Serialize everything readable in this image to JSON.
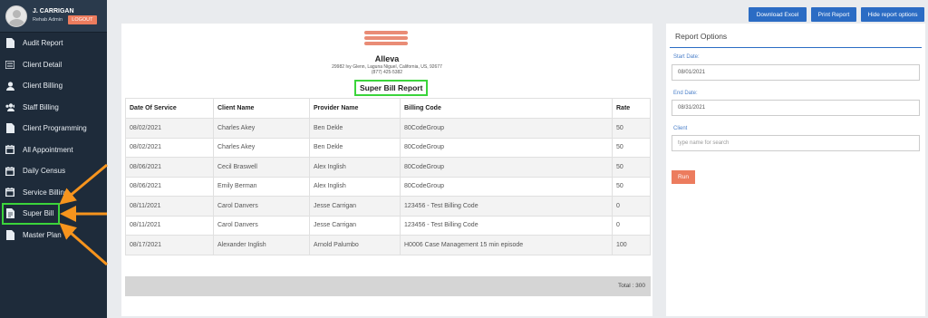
{
  "profile": {
    "name": "J. CARRIGAN",
    "role": "Rehab Admin",
    "logout": "LOGOUT"
  },
  "nav": [
    {
      "label": "Audit Report",
      "icon": "file-icon"
    },
    {
      "label": "Client Detail",
      "icon": "list-icon"
    },
    {
      "label": "Client Billing",
      "icon": "user-icon"
    },
    {
      "label": "Staff Billing",
      "icon": "users-icon"
    },
    {
      "label": "Client Programming",
      "icon": "file-icon"
    },
    {
      "label": "All Appointment",
      "icon": "calendar-icon"
    },
    {
      "label": "Daily Census",
      "icon": "calendar-icon"
    },
    {
      "label": "Service Billing",
      "icon": "calendar-icon"
    },
    {
      "label": "Super Bill",
      "icon": "document-icon"
    },
    {
      "label": "Master Plan",
      "icon": "file-icon"
    }
  ],
  "toolbar": {
    "download": "Download Excel",
    "print": "Print Report",
    "hide": "Hide report options"
  },
  "company": {
    "name": "Alleva",
    "address": "29982 Ivy Glenn, Laguna Niguel, California, US, 92677",
    "phone": "(877) 425-5382"
  },
  "report_title": "Super Bill Report",
  "table": {
    "headers": [
      "Date Of Service",
      "Client Name",
      "Provider Name",
      "Billing Code",
      "Rate"
    ],
    "rows": [
      [
        "08/02/2021",
        "Charles Akey",
        "Ben Dekle",
        "80CodeGroup",
        "50"
      ],
      [
        "08/02/2021",
        "Charles Akey",
        "Ben Dekle",
        "80CodeGroup",
        "50"
      ],
      [
        "08/06/2021",
        "Cecil Braswell",
        "Alex Inglish",
        "80CodeGroup",
        "50"
      ],
      [
        "08/06/2021",
        "Emily Berman",
        "Alex Inglish",
        "80CodeGroup",
        "50"
      ],
      [
        "08/11/2021",
        "Carol Danvers",
        "Jesse Carrigan",
        "123456 - Test Billing Code",
        "0"
      ],
      [
        "08/11/2021",
        "Carol Danvers",
        "Jesse Carrigan",
        "123456 - Test Billing Code",
        "0"
      ],
      [
        "08/17/2021",
        "Alexander Inglish",
        "Arnold Palumbo",
        "H0006 Case Management 15 min episode",
        "100"
      ]
    ],
    "total": "Total : 300"
  },
  "options": {
    "title": "Report Options",
    "start_label": "Start Date:",
    "start_value": "08/01/2021",
    "end_label": "End Date:",
    "end_value": "08/31/2021",
    "client_label": "Client",
    "client_placeholder": "type name for search",
    "run": "Run"
  },
  "colors": {
    "sidebar": "#1e2b3a",
    "accent_blue": "#2b6cc4",
    "accent_orange": "#ec7c5e",
    "highlight_green": "#3bd43b",
    "annotation_arrow": "#f7941d"
  }
}
